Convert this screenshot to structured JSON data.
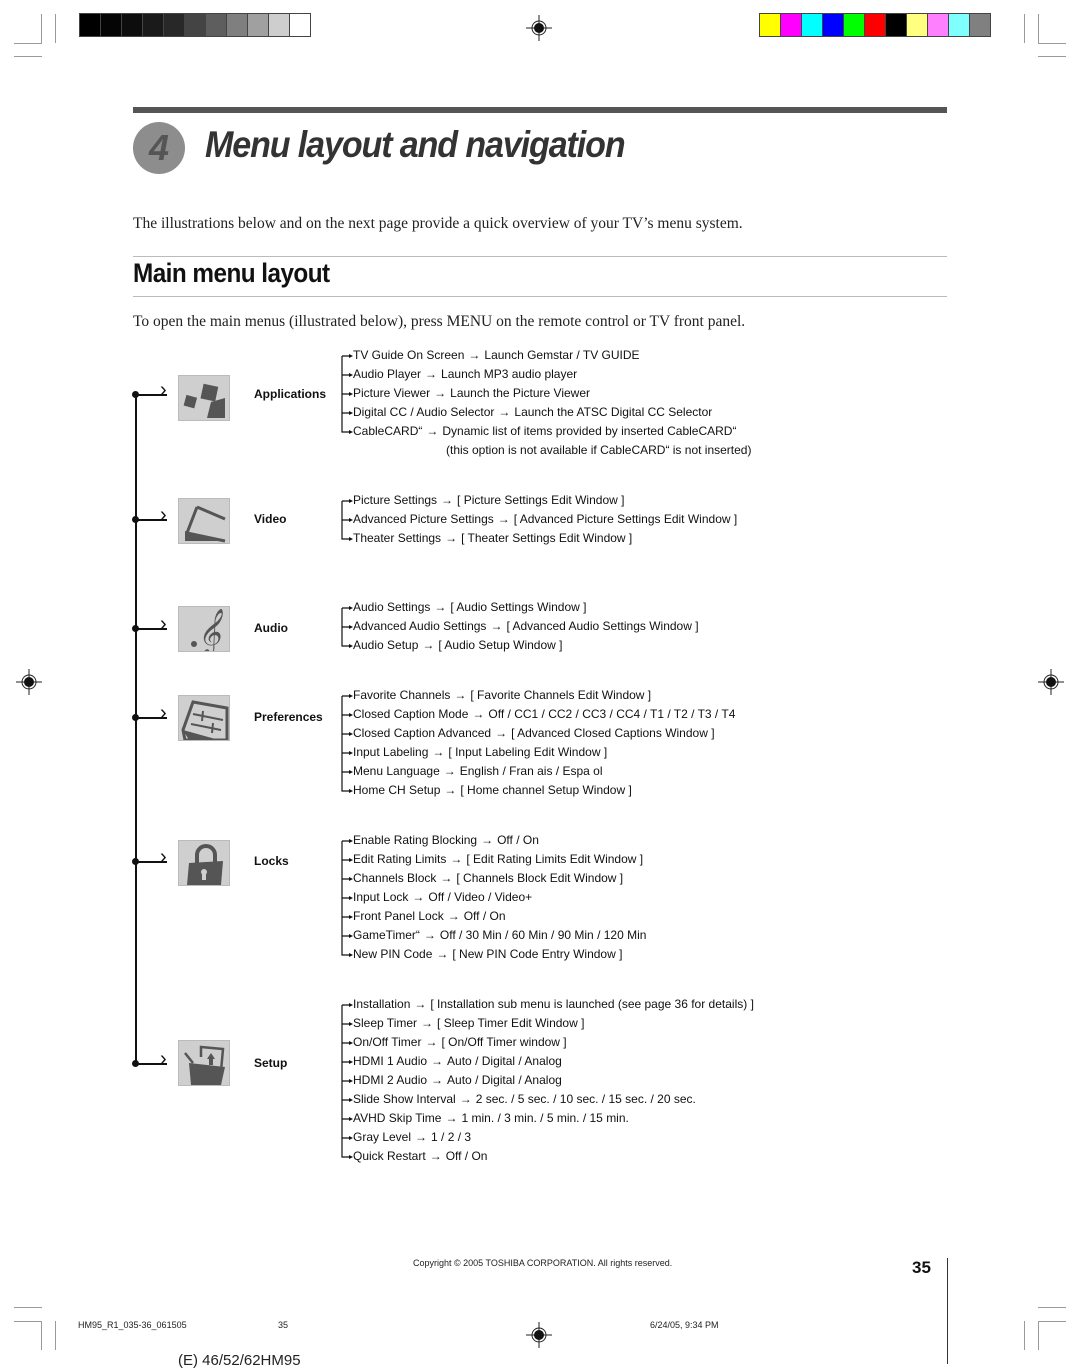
{
  "print_marks": {
    "gray_swatches": [
      "#000000",
      "#050505",
      "#0d0d0d",
      "#1a1a1a",
      "#282828",
      "#444444",
      "#5e5e5e",
      "#7f7f7f",
      "#a0a0a0",
      "#cecece",
      "#ffffff"
    ],
    "color_swatches": [
      "#ffff00",
      "#ff00ff",
      "#00ffff",
      "#0000ff",
      "#00ff00",
      "#ff0000",
      "#000000",
      "#ffff80",
      "#ff80ff",
      "#80ffff",
      "#808080"
    ]
  },
  "header": {
    "chapter_number": "4",
    "chapter_title": "Menu layout and navigation",
    "intro": "The illustrations below and on the next page provide a quick overview of your TV’s menu system."
  },
  "section": {
    "title": "Main menu layout",
    "intro": "To open the main menus (illustrated below), press MENU on the remote control or TV front panel."
  },
  "menus": [
    {
      "label": "Applications",
      "icon": "applications-icon",
      "items": [
        {
          "name": "TV Guide On Screen",
          "arrow": "→",
          "value": "Launch Gemstar / TV GUIDE"
        },
        {
          "name": "Audio Player",
          "arrow": "→",
          "value": "Launch MP3 audio player"
        },
        {
          "name": "Picture Viewer",
          "arrow": "→",
          "value": "Launch the Picture Viewer"
        },
        {
          "name": "Digital CC / Audio Selector",
          "arrow": "→",
          "value": "Launch the ATSC Digital CC Selector"
        },
        {
          "name": "CableCARD“",
          "arrow": "→",
          "value": "Dynamic list of items provided by inserted CableCARD“"
        }
      ],
      "note": "(this option is not available if CableCARD“ is not inserted)"
    },
    {
      "label": "Video",
      "icon": "video-icon",
      "items": [
        {
          "name": "Picture Settings",
          "arrow": "→",
          "value": "[ Picture Settings Edit Window ]"
        },
        {
          "name": "Advanced Picture Settings",
          "arrow": "→",
          "value": "[ Advanced Picture Settings Edit Window ]"
        },
        {
          "name": "Theater Settings",
          "arrow": "→",
          "value": "[ Theater Settings Edit Window ]"
        }
      ]
    },
    {
      "label": "Audio",
      "icon": "treble-clef-icon",
      "items": [
        {
          "name": "Audio Settings",
          "arrow": "→",
          "value": "[ Audio Settings Window ]"
        },
        {
          "name": "Advanced Audio Settings",
          "arrow": "→",
          "value": "[ Advanced Audio Settings Window ]"
        },
        {
          "name": "Audio Setup",
          "arrow": "→",
          "value": "[ Audio Setup Window ]"
        }
      ]
    },
    {
      "label": "Preferences",
      "icon": "sliders-icon",
      "items": [
        {
          "name": "Favorite Channels",
          "arrow": "→",
          "value": "[ Favorite Channels Edit Window ]"
        },
        {
          "name": "Closed Caption Mode",
          "arrow": "→",
          "value": "Off / CC1 / CC2 / CC3 / CC4 / T1 / T2 / T3 / T4"
        },
        {
          "name": "Closed Caption Advanced",
          "arrow": "→",
          "value": "[ Advanced Closed Captions Window ]"
        },
        {
          "name": "Input Labeling",
          "arrow": "→",
          "value": "[ Input Labeling Edit Window ]"
        },
        {
          "name": "Menu Language",
          "arrow": "→",
          "value": "English / Fran ais / Espa ol"
        },
        {
          "name": "Home CH Setup",
          "arrow": "→",
          "value": "[ Home channel Setup Window ]"
        }
      ]
    },
    {
      "label": "Locks",
      "icon": "padlock-icon",
      "items": [
        {
          "name": "Enable Rating Blocking",
          "arrow": "→",
          "value": "Off / On"
        },
        {
          "name": "Edit Rating Limits",
          "arrow": "→",
          "value": "[ Edit Rating Limits Edit Window ]"
        },
        {
          "name": "Channels Block",
          "arrow": "→",
          "value": "[ Channels Block Edit Window ]"
        },
        {
          "name": "Input Lock",
          "arrow": "→",
          "value": "Off / Video / Video+"
        },
        {
          "name": "Front Panel Lock",
          "arrow": "→",
          "value": "Off / On"
        },
        {
          "name": "GameTimer“",
          "arrow": "→",
          "value": "Off / 30 Min / 60 Min / 90 Min / 120 Min"
        },
        {
          "name": "New PIN Code",
          "arrow": "→",
          "value": "[ New PIN Code Entry Window ]"
        }
      ]
    },
    {
      "label": "Setup",
      "icon": "setup-toolbox-icon",
      "items": [
        {
          "name": "Installation",
          "arrow": "→",
          "value": "[ Installation sub menu is launched (see page 36 for details) ]"
        },
        {
          "name": "Sleep Timer",
          "arrow": "→",
          "value": "[ Sleep Timer Edit Window ]"
        },
        {
          "name": "On/Off Timer",
          "arrow": "→",
          "value": "[ On/Off Timer window ]"
        },
        {
          "name": "HDMI 1 Audio",
          "arrow": "→",
          "value": "Auto / Digital / Analog"
        },
        {
          "name": "HDMI 2 Audio",
          "arrow": "→",
          "value": "Auto / Digital / Analog"
        },
        {
          "name": "Slide Show Interval",
          "arrow": "→",
          "value": "2 sec. / 5 sec. / 10 sec. / 15 sec. / 20 sec."
        },
        {
          "name": "AVHD Skip Time",
          "arrow": "→",
          "value": "1 min. / 3 min. / 5 min. / 15 min."
        },
        {
          "name": "Gray Level",
          "arrow": "→",
          "value": "1 / 2 / 3"
        },
        {
          "name": "Quick Restart",
          "arrow": "→",
          "value": "Off / On"
        }
      ]
    }
  ],
  "footer": {
    "copyright": "Copyright © 2005 TOSHIBA CORPORATION. All rights reserved.",
    "page_number": "35",
    "slug_file": "HM95_R1_035-36_061505",
    "slug_page": "35",
    "slug_date": "6/24/05, 9:34 PM",
    "model": "(E) 46/52/62HM95"
  }
}
